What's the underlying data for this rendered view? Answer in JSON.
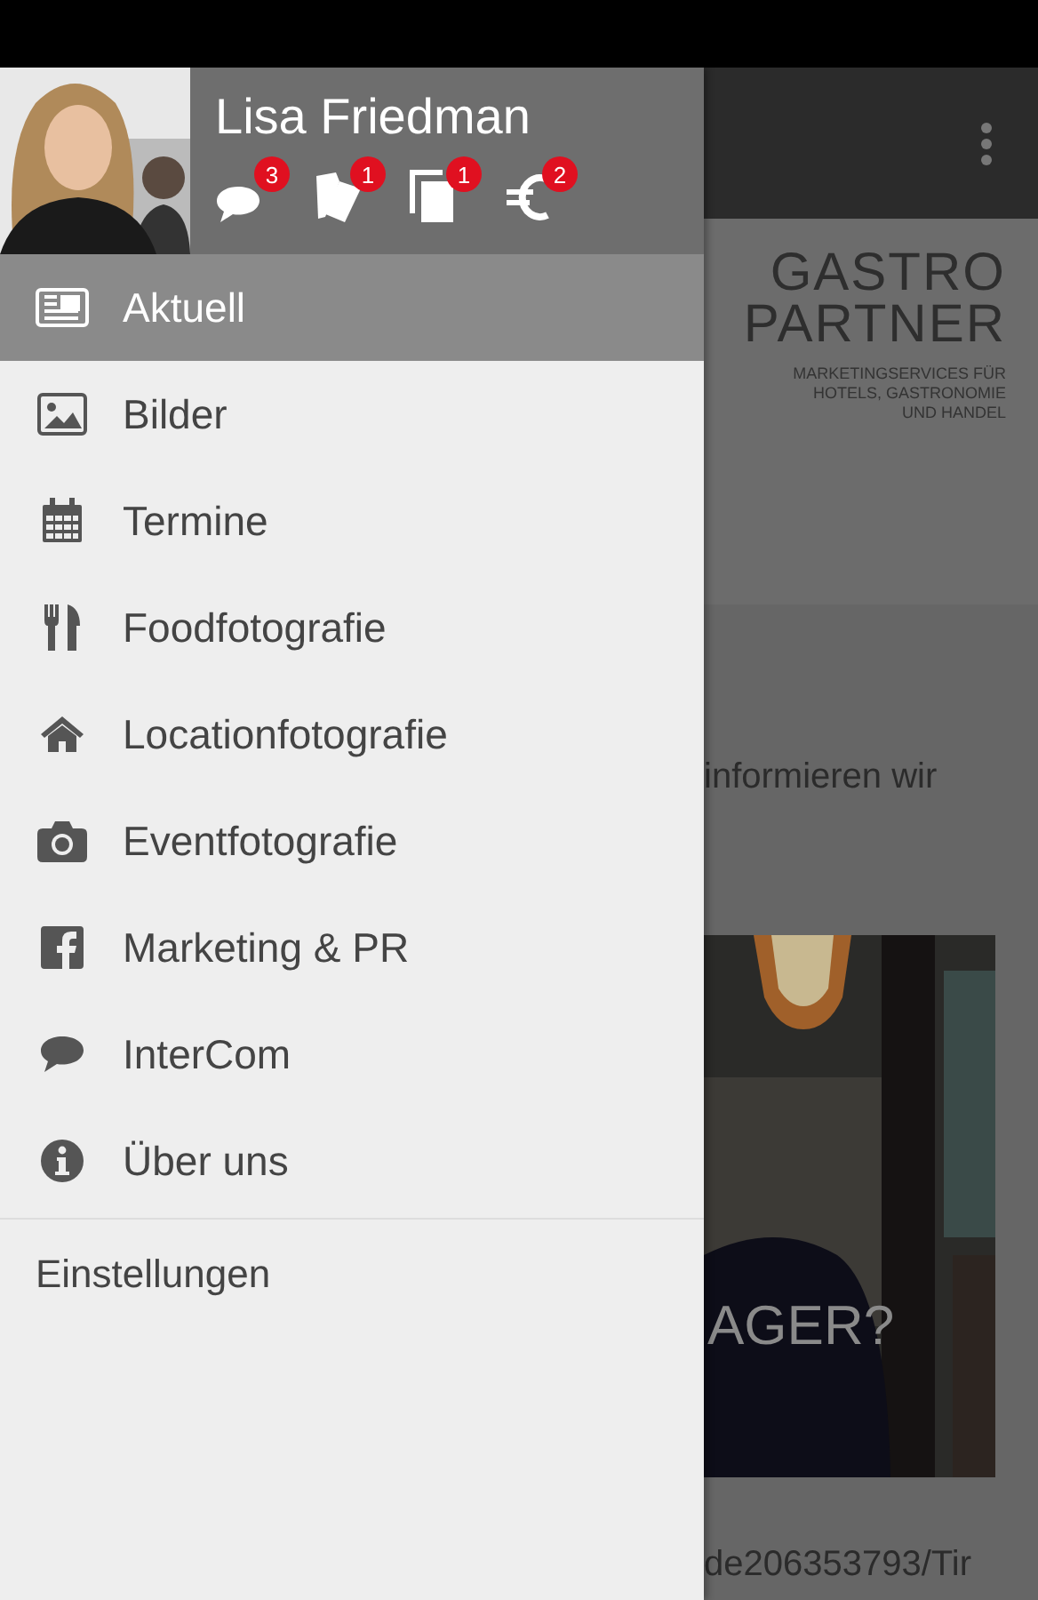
{
  "user": {
    "name": "Lisa Friedman"
  },
  "header_actions": [
    {
      "badge": "3"
    },
    {
      "badge": "1"
    },
    {
      "badge": "1"
    },
    {
      "badge": "2"
    }
  ],
  "menu": [
    {
      "label": "Aktuell",
      "selected": true
    },
    {
      "label": "Bilder",
      "selected": false
    },
    {
      "label": "Termine",
      "selected": false
    },
    {
      "label": "Foodfotografie",
      "selected": false
    },
    {
      "label": "Locationfotografie",
      "selected": false
    },
    {
      "label": "Eventfotografie",
      "selected": false
    },
    {
      "label": "Marketing & PR",
      "selected": false
    },
    {
      "label": "InterCom",
      "selected": false
    },
    {
      "label": "Über uns",
      "selected": false
    }
  ],
  "footer_menu": [
    {
      "label": "Einstellungen"
    }
  ],
  "background_page": {
    "logo_lines": [
      "GASTRO",
      "PARTNER"
    ],
    "tagline_lines": [
      "MARKETINGSERVICES FÜR",
      "HOTELS, GASTRONOMIE",
      "UND HANDEL"
    ],
    "text": "informieren wir",
    "banner": {
      "kind": "picture",
      "caption": "AGER?"
    },
    "link": "de206353793/Tir"
  }
}
